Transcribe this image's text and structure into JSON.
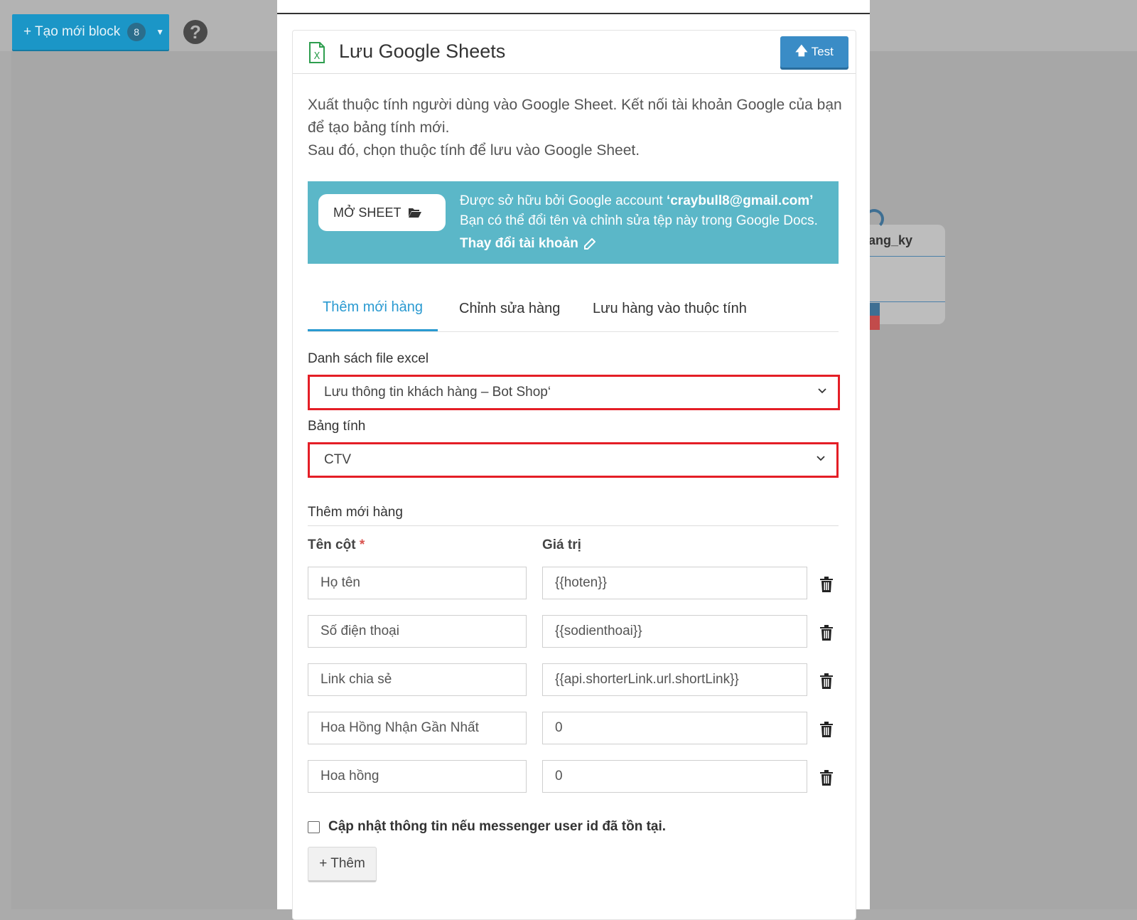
{
  "toolbar": {
    "create_label": "+ Tạo mới block",
    "create_count": "8"
  },
  "canvas": {
    "node_title": "ang_ky"
  },
  "panel": {
    "title": "Lưu Google Sheets",
    "test_label": "Test",
    "description": [
      "Xuất thuộc tính người dùng vào Google Sheet. Kết nối tài khoản Google của bạn",
      "để tạo bảng tính mới.",
      "Sau đó, chọn thuộc tính để lưu vào Google Sheet."
    ]
  },
  "info": {
    "open_sheet_label": "MỞ SHEET",
    "owner_prefix": "Được sở hữu bởi Google account ",
    "owner_email": "‘craybull8@gmail.com’",
    "rename_text": "Bạn có thể đổi tên và chỉnh sửa tệp này trong Google Docs.",
    "change_account_label": "Thay đổi tài khoản"
  },
  "tabs": [
    "Thêm mới hàng",
    "Chỉnh sửa hàng",
    "Lưu hàng vào thuộc tính"
  ],
  "form": {
    "file_list_label": "Danh sách file excel",
    "file_selected": "Lưu thông tin khách hàng – Bot Shop‘",
    "sheet_label": "Bảng tính",
    "sheet_selected": "CTV",
    "section_title": "Thêm mới hàng",
    "col_name_header": "Tên cột",
    "required_mark": "*",
    "col_value_header": "Giá trị",
    "rows": [
      {
        "name": "Họ tên",
        "value": "{{hoten}}"
      },
      {
        "name": "Số điện thoại",
        "value": "{{sodienthoai}}"
      },
      {
        "name": "Link chia sẻ",
        "value": "{{api.shorterLink.url.shortLink}}"
      },
      {
        "name": "Hoa Hồng Nhận Gần Nhất",
        "value": "0"
      },
      {
        "name": "Hoa hồng",
        "value": "0"
      }
    ],
    "update_checkbox_label": "Cập nhật thông tin nếu messenger user id đã tồn tại.",
    "add_label": "+ Thêm"
  },
  "colors": {
    "primary": "#1b96c7",
    "info_bg": "#5bb7c8",
    "highlight": "#e41e26",
    "tab_active": "#2a9ad1"
  },
  "icons": [
    "chevron-down-icon",
    "help-icon",
    "excel-sheet-icon",
    "arrow-up-icon",
    "folder-open-icon",
    "pencil-icon",
    "trash-icon"
  ]
}
